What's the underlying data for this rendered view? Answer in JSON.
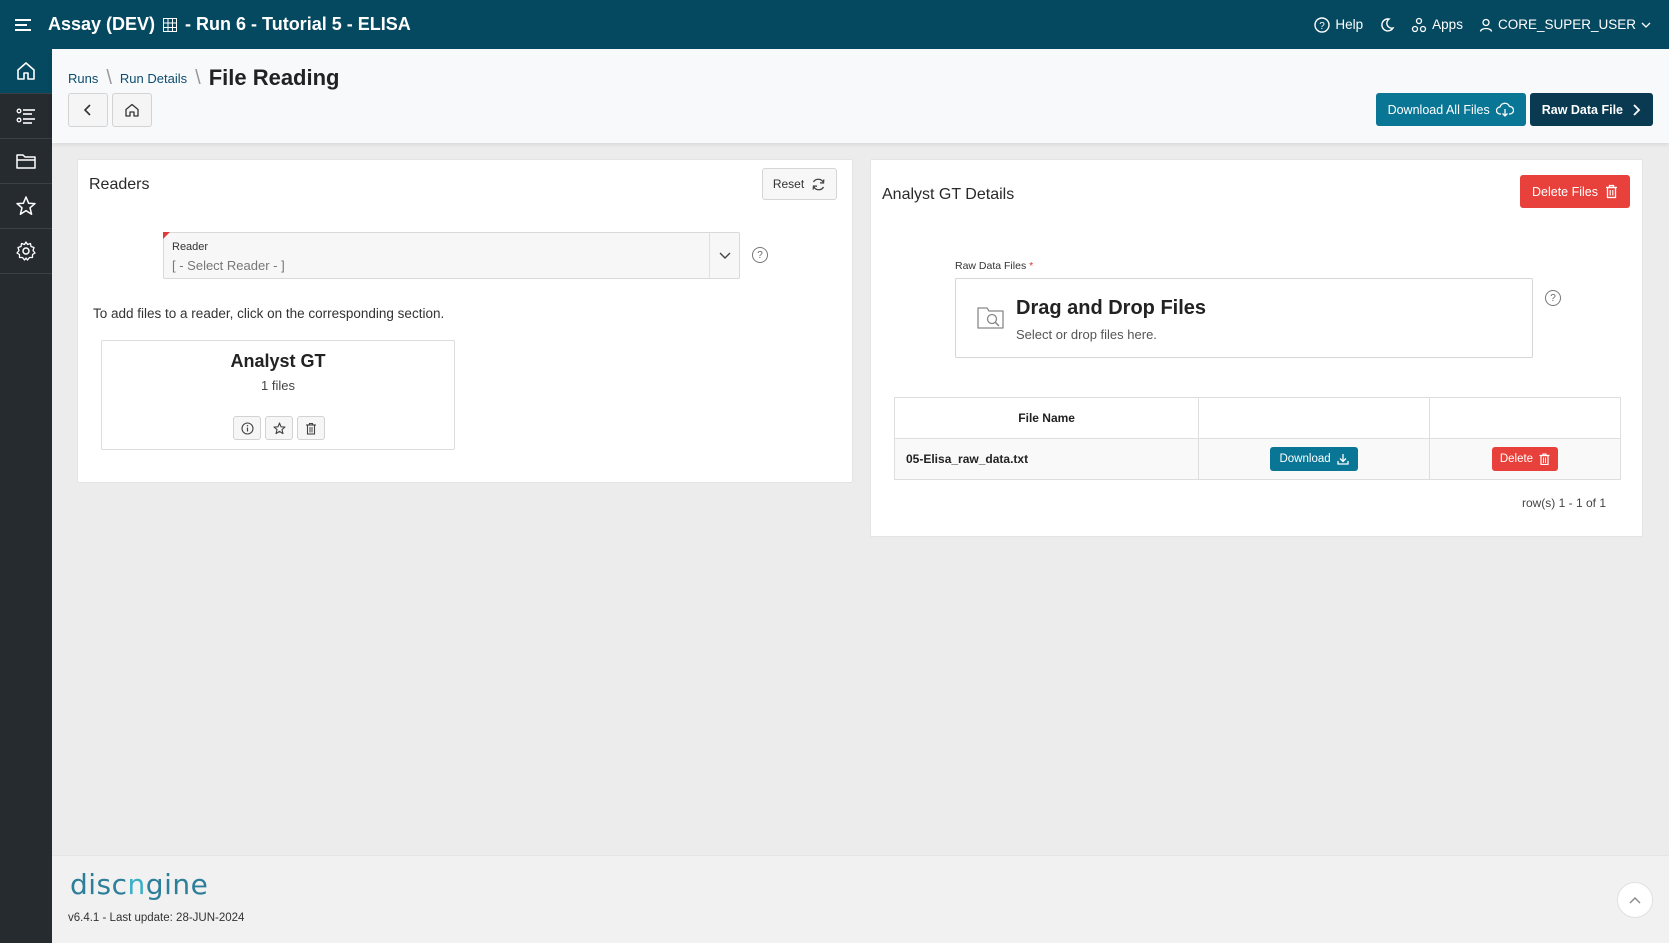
{
  "header": {
    "title": "Assay (DEV)",
    "subtitle": "- Run 6 - Tutorial 5 - ELISA",
    "help_label": "Help",
    "apps_label": "Apps",
    "user_label": "CORE_SUPER_USER"
  },
  "sidebar": {
    "items": [
      {
        "name": "home-icon"
      },
      {
        "name": "list-icon"
      },
      {
        "name": "folder-icon"
      },
      {
        "name": "star-icon"
      },
      {
        "name": "gear-icon"
      }
    ]
  },
  "breadcrumb": {
    "items": [
      "Runs",
      "Run Details"
    ],
    "current": "File Reading"
  },
  "actions": {
    "download_all": "Download All Files",
    "raw_data_file": "Raw Data File"
  },
  "readers": {
    "title": "Readers",
    "reset_label": "Reset",
    "select_label": "Reader",
    "select_placeholder": "[ - Select Reader - ]",
    "hint": "To add files to a reader, click on the corresponding section.",
    "cards": [
      {
        "name": "Analyst GT",
        "count": "1 files"
      }
    ]
  },
  "details": {
    "title": "Analyst GT Details",
    "delete_files_label": "Delete Files",
    "raw_files_label": "Raw Data Files",
    "required_mark": "*",
    "dropzone_title": "Drag and Drop Files",
    "dropzone_sub": "Select or drop files here.",
    "table": {
      "columns": [
        "File Name",
        "",
        ""
      ],
      "rows": [
        {
          "file": "05-Elisa_raw_data.txt",
          "download": "Download",
          "delete": "Delete"
        }
      ]
    },
    "row_count": "row(s) 1 - 1 of 1"
  },
  "footer": {
    "logo": "discngine",
    "version": "v6.4.1 - Last update: 28-JUN-2024"
  },
  "colors": {
    "header": "#054960",
    "sidebar": "#262b30",
    "primary": "#0a7696",
    "danger": "#e8403a"
  }
}
